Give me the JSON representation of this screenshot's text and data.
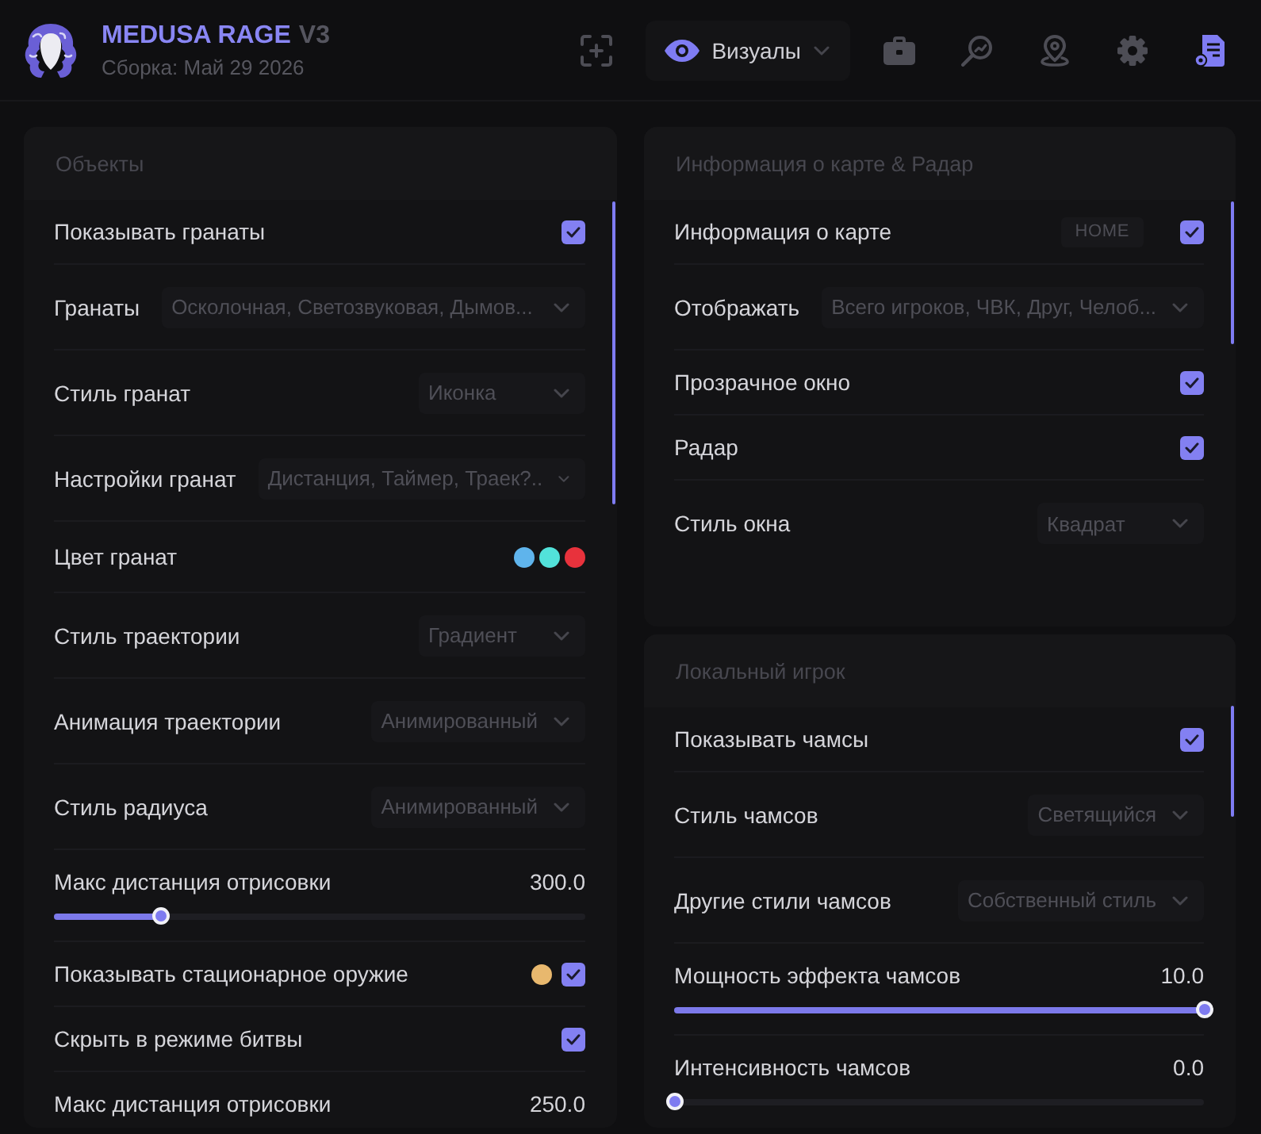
{
  "header": {
    "title": "MEDUSA RAGE",
    "version": "V3",
    "build": "Сборка: Май 29 2026"
  },
  "toolbar": [
    {
      "kind": "focus",
      "selected": false
    },
    {
      "kind": "category",
      "label": "Визуалы",
      "selected": true
    },
    {
      "kind": "briefcase",
      "selected": false
    },
    {
      "kind": "search",
      "selected": false
    },
    {
      "kind": "pin",
      "selected": false
    },
    {
      "kind": "gear",
      "selected": false
    },
    {
      "kind": "config",
      "selected": true
    }
  ],
  "columns": [
    {
      "panels": [
        {
          "title": "Объекты",
          "rows": [
            {
              "kind": "checkbox",
              "label": "Показывать гранаты",
              "checked": true
            },
            {
              "kind": "multiselect",
              "label": "Гранаты",
              "value": "Осколочная, Светозвуковая, Дымов..."
            },
            {
              "kind": "select",
              "label": "Стиль гранат",
              "value": "Иконка"
            },
            {
              "kind": "multiselect",
              "label": "Настройки гранат",
              "value": "Дистанция, Таймер, Траек?.."
            },
            {
              "kind": "colors",
              "label": "Цвет гранат",
              "colors": [
                {
                  "color": "#5fb4ec"
                },
                {
                  "color": "#52e2da"
                },
                {
                  "color": "#e8323c"
                }
              ]
            },
            {
              "kind": "select",
              "label": "Стиль траектории",
              "value": "Градиент"
            },
            {
              "kind": "select",
              "label": "Анимация траектории",
              "value": "Анимированный"
            },
            {
              "kind": "select",
              "label": "Стиль радиуса",
              "value": "Анимированный"
            },
            {
              "kind": "slider",
              "label": "Макс дистанция отрисовки",
              "reading": "300.0",
              "level": 0.2
            },
            {
              "kind": "checkbox",
              "label": "Показывать стационарное оружие",
              "color": "#e8b86e",
              "checked": true
            },
            {
              "kind": "checkbox",
              "label": "Скрыть в режиме битвы",
              "checked": true
            },
            {
              "kind": "slider",
              "label": "Макс дистанция отрисовки",
              "reading": "250.0"
            }
          ]
        }
      ]
    },
    {
      "panels": [
        {
          "title": "Информация о карте & Радар",
          "rows": [
            {
              "kind": "checkbox",
              "label": "Информация о карте",
              "badge": "HOME",
              "checked": true
            },
            {
              "kind": "multiselect",
              "label": "Отображать",
              "value": "Всего игроков, ЧВК, Друг, Челоб..."
            },
            {
              "kind": "checkbox",
              "label": "Прозрачное окно",
              "checked": true
            },
            {
              "kind": "checkbox",
              "label": "Радар",
              "checked": true
            },
            {
              "kind": "select",
              "label": "Стиль окна",
              "value": "Квадрат"
            }
          ]
        },
        {
          "title": "Локальный игрок",
          "rows": [
            {
              "kind": "checkbox",
              "label": "Показывать чамсы",
              "checked": true
            },
            {
              "kind": "select",
              "label": "Стиль чамсов",
              "value": "Светящийся"
            },
            {
              "kind": "select",
              "label": "Другие стили чамсов",
              "value": "Собственный стиль"
            },
            {
              "kind": "slider",
              "label": "Мощность эффекта чамсов",
              "reading": "10.0",
              "level": 1
            },
            {
              "kind": "slider",
              "label": "Интенсивность чамсов",
              "reading": "0.0",
              "level": 0
            }
          ]
        }
      ]
    }
  ]
}
